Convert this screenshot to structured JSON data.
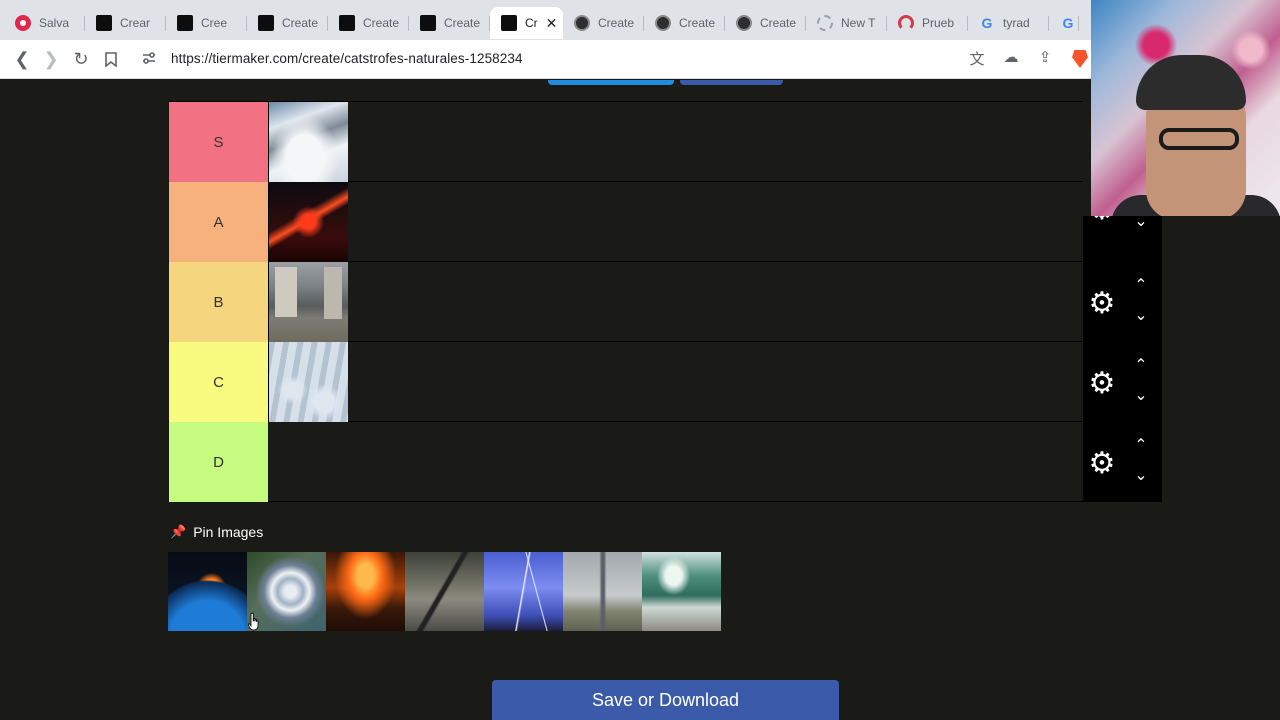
{
  "browser": {
    "tabs": [
      {
        "label": "Salva",
        "icon": "youtube-icon",
        "active": false
      },
      {
        "label": "Crear",
        "icon": "tiermaker-icon",
        "active": false
      },
      {
        "label": "Cree",
        "icon": "tiermaker-icon",
        "active": false
      },
      {
        "label": "Create",
        "icon": "tiermaker-icon",
        "active": false
      },
      {
        "label": "Create",
        "icon": "tiermaker-icon",
        "active": false
      },
      {
        "label": "Create",
        "icon": "tiermaker-icon",
        "active": false
      },
      {
        "label": "Cr",
        "icon": "tiermaker-icon",
        "active": true
      },
      {
        "label": "Create",
        "icon": "chatgpt-icon",
        "active": false
      },
      {
        "label": "Create",
        "icon": "chatgpt-icon",
        "active": false
      },
      {
        "label": "Create",
        "icon": "chatgpt-icon",
        "active": false
      },
      {
        "label": "New T",
        "icon": "new-tab-icon",
        "active": false
      },
      {
        "label": "Prueb",
        "icon": "speedtest-icon",
        "active": false
      },
      {
        "label": "tyrad",
        "icon": "google-icon",
        "active": false
      }
    ],
    "url": "https://tiermaker.com/create/catstrofes-naturales-1258234"
  },
  "tierlist": {
    "tiers": [
      {
        "label": "S",
        "color": "#f27284",
        "items": [
          "avalanche-image"
        ]
      },
      {
        "label": "A",
        "color": "#f6b17c",
        "items": [
          "volcano-image"
        ]
      },
      {
        "label": "B",
        "color": "#f5d67f",
        "items": [
          "flood-image"
        ]
      },
      {
        "label": "C",
        "color": "#f8fb80",
        "items": [
          "blizzard-image"
        ]
      },
      {
        "label": "D",
        "color": "#c5fb7f",
        "items": []
      }
    ],
    "pin_label": "Pin Images",
    "pool": [
      "meteor-image",
      "hurricane-image",
      "wildfire-image",
      "earthquake-image",
      "lightning-image",
      "tornado-image",
      "tsunami-image"
    ],
    "save_label": "Save or Download"
  },
  "colors": {
    "save_button": "#3b5baa",
    "page_bg": "#1a1a17",
    "top_button_left": "#1f8de0",
    "top_button_right": "#3b5baa"
  }
}
